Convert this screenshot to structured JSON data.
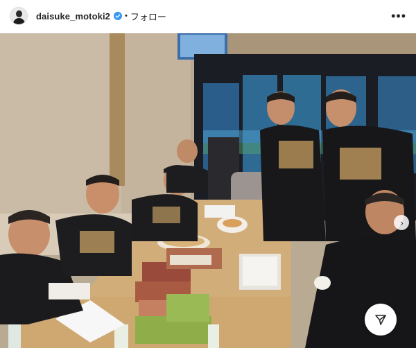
{
  "header": {
    "username": "daisuke_motoki2",
    "separator": "•",
    "follow_label": "フォロー",
    "more_label": "•••"
  },
  "icons": {
    "avatar": "avatar-icon",
    "verified": "verified-badge-icon",
    "more": "more-options-icon",
    "next": "chevron-right-icon",
    "share": "share-icon"
  },
  "colors": {
    "verified_blue": "#3897f0",
    "text": "#262626"
  },
  "photo": {
    "description_alt": ""
  }
}
